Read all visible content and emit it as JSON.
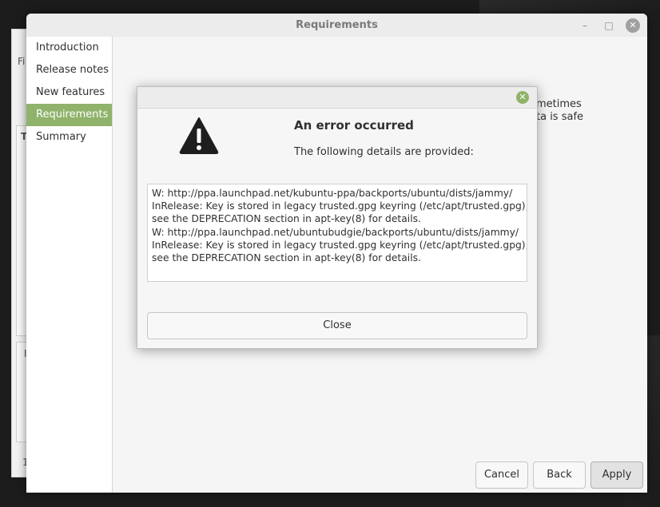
{
  "window": {
    "title": "Requirements",
    "minimize_glyph": "–",
    "maximize_glyph": "□",
    "close_glyph": "✕"
  },
  "background_window": {
    "fragments": [
      "Fi",
      "T",
      "I",
      "1"
    ]
  },
  "sidebar": {
    "items": [
      {
        "label": "Introduction",
        "active": false
      },
      {
        "label": "Release notes",
        "active": false
      },
      {
        "label": "New features",
        "active": false
      },
      {
        "label": "Requirements",
        "active": true
      },
      {
        "label": "Summary",
        "active": false
      }
    ]
  },
  "content": {
    "partial_text_line1": "metimes",
    "partial_text_line2": "ta is safe"
  },
  "buttons": {
    "cancel": "Cancel",
    "back": "Back",
    "apply": "Apply"
  },
  "dialog": {
    "heading": "An error occurred",
    "subheading": "The following details are provided:",
    "details": "W: http://ppa.launchpad.net/kubuntu-ppa/backports/ubuntu/dists/jammy/\nInRelease: Key is stored in legacy trusted.gpg keyring (/etc/apt/trusted.gpg),\nsee the DEPRECATION section in apt-key(8) for details.\nW: http://ppa.launchpad.net/ubuntubudgie/backports/ubuntu/dists/jammy/\nInRelease: Key is stored in legacy trusted.gpg keyring (/etc/apt/trusted.gpg),\nsee the DEPRECATION section in apt-key(8) for details.",
    "close_button": "Close",
    "close_glyph": "✕",
    "icon": "warning-icon"
  },
  "colors": {
    "accent": "#8fb36a",
    "desktop": "#1c1c1c"
  }
}
